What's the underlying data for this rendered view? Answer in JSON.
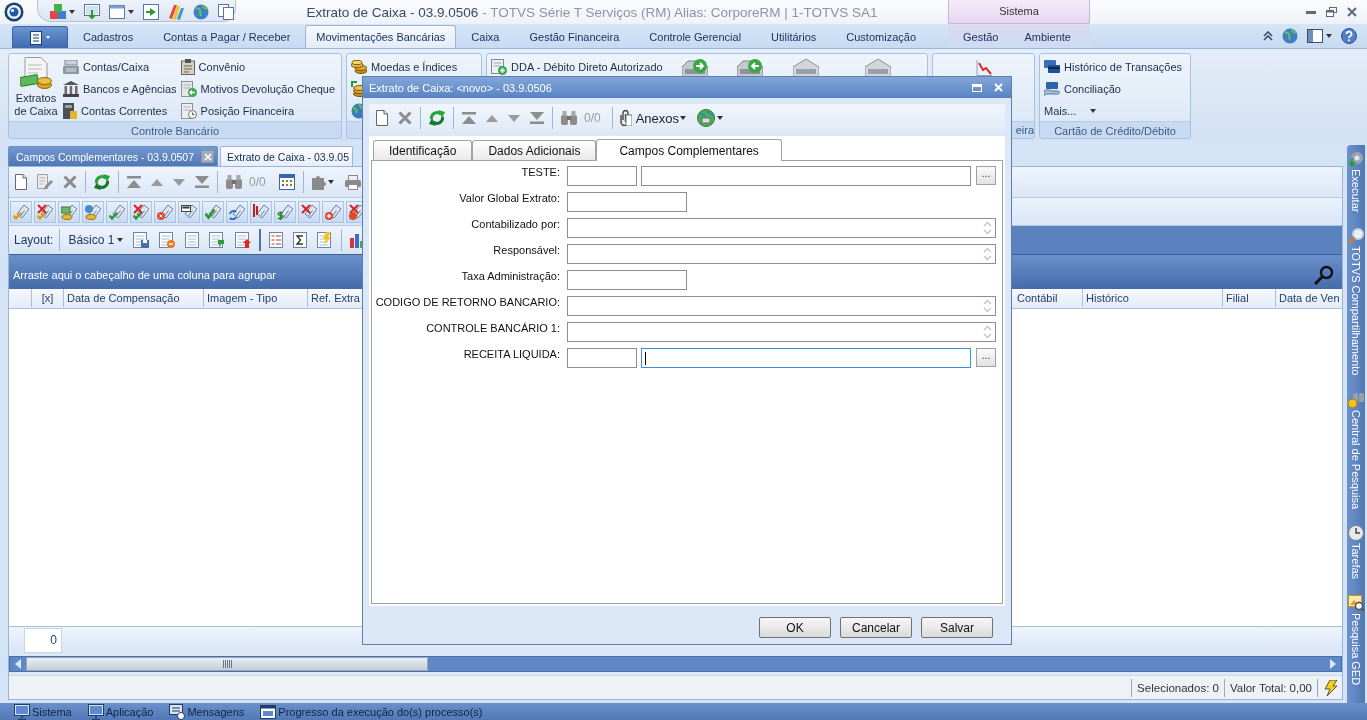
{
  "title_bar": {
    "title": "Extrato de Caixa - 03.9.0506",
    "app_info": "- TOTVS Série T Serviços (RM) Alias: CorporeRM | 1-TOTVS SA1"
  },
  "ribbon": {
    "tabs": [
      {
        "label": "Cadastros",
        "selected": false
      },
      {
        "label": "Contas a Pagar / Receber",
        "selected": false
      },
      {
        "label": "Movimentações Bancárias",
        "selected": true
      },
      {
        "label": "Caixa",
        "selected": false
      },
      {
        "label": "Gestão Financeira",
        "selected": false
      },
      {
        "label": "Controle Gerencial",
        "selected": false
      },
      {
        "label": "Utilitários",
        "selected": false
      },
      {
        "label": "Customização",
        "selected": false
      }
    ],
    "context_group": {
      "label": "Sistema",
      "tabs": [
        {
          "label": "Gestão",
          "selected": false
        },
        {
          "label": "Ambiente",
          "selected": false
        }
      ]
    },
    "groups": [
      {
        "label": "Controle Bancário",
        "large_button": "Extratos de Caixa",
        "items": [
          "Contas/Caixa",
          "Bancos e Agências",
          "Contas Correntes",
          "Convênio",
          "Motivos Devolução Cheque",
          "Posição Financeira"
        ]
      },
      {
        "items": [
          "Moedas e Índices"
        ]
      },
      {
        "items": [
          "DDA - Débito Direto Autorizado"
        ]
      },
      {
        "label": "eira"
      },
      {
        "label": "Cartão de Crédito/Débito",
        "items": [
          "Histórico de Transações",
          "Conciliação"
        ],
        "more": "Mais..."
      }
    ]
  },
  "document_tabs": [
    {
      "label": "Campos Complementares - 03.9.0507",
      "selected": false,
      "closable": true
    },
    {
      "label": "Extrato de Caixa - 03.9.05",
      "selected": true,
      "closable": false
    }
  ],
  "toolbar": {
    "counter": "0/0"
  },
  "layout_bar": {
    "label": "Layout:",
    "layout": "Básico 1"
  },
  "grid": {
    "group_hint": "Arraste aqui o cabeçalho de uma coluna para agrupar",
    "columns_left": [
      "[x]",
      "Data de Compensação",
      "Imagem - Tipo",
      "Ref. Extra"
    ],
    "columns_right": [
      "Contábil",
      "Histórico",
      "Filial",
      "Data de Ven"
    ],
    "record_count": "0"
  },
  "status_bar": {
    "selected_count": "Selecionados: 0",
    "total": "Valor Total: 0,00"
  },
  "side_panel": {
    "items": [
      "Executar",
      "TOTVS Compartilhamento",
      "Central de Pesquisa",
      "Tarefas",
      "Pesquisa GED"
    ]
  },
  "taskbar": {
    "items": [
      "Sistema",
      "Aplicação",
      "Mensagens",
      "Progresso da execução do(s) processo(s)"
    ]
  },
  "dialog": {
    "title": "Extrato de Caixa: <novo> - 03.9.0506",
    "counter": "0/0",
    "attachments": "Anexos",
    "tabs": [
      {
        "label": "Identificação",
        "selected": false
      },
      {
        "label": "Dados Adicionais",
        "selected": false
      },
      {
        "label": "Campos Complementares",
        "selected": true
      }
    ],
    "fields": [
      {
        "label": "TESTE:",
        "kind": "lookup",
        "button": "...",
        "focused": false
      },
      {
        "label": "Valor Global Extrato:",
        "kind": "short",
        "focused": false
      },
      {
        "label": "Contabilizado por:",
        "kind": "memo",
        "focused": false
      },
      {
        "label": "Responsável:",
        "kind": "memo",
        "focused": false
      },
      {
        "label": "Taxa Administração:",
        "kind": "short",
        "focused": false
      },
      {
        "label": "CODIGO DE RETORNO BANCARIO:",
        "kind": "memo",
        "focused": false
      },
      {
        "label": "CONTROLE BANCÁRIO 1:",
        "kind": "memo",
        "focused": false
      },
      {
        "label": "RECEITA LIQUIDA:",
        "kind": "lookup",
        "button": "...",
        "focused": true
      }
    ],
    "buttons": [
      "OK",
      "Cancelar",
      "Salvar"
    ]
  }
}
